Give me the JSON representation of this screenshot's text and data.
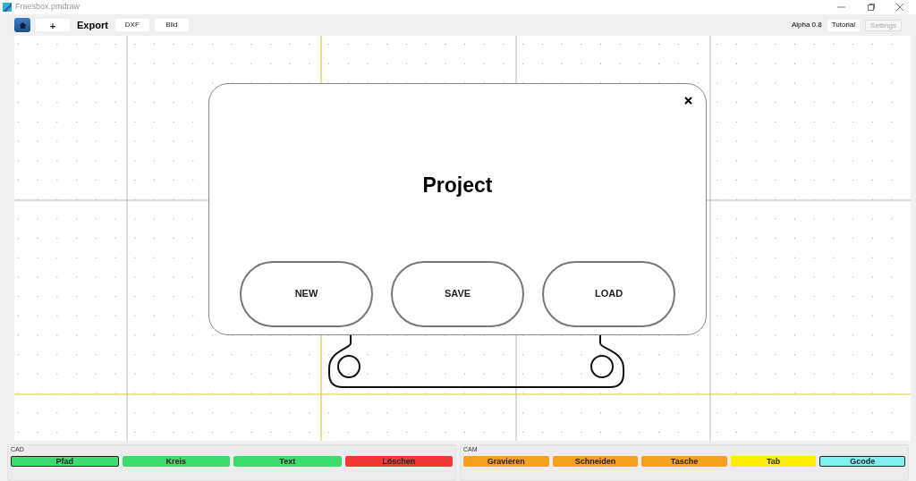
{
  "window": {
    "title": "Fraesbox.pmdraw"
  },
  "toolbar": {
    "left": [
      {
        "kind": "home"
      },
      {
        "kind": "button",
        "label": "+"
      },
      {
        "kind": "label",
        "label": "Export"
      },
      {
        "kind": "button",
        "label": "DXF"
      },
      {
        "kind": "button",
        "label": "Bild"
      }
    ],
    "version": "Alpha 0.8",
    "right": [
      {
        "label": "Tutorial",
        "disabled": false
      },
      {
        "label": "Settings",
        "disabled": true
      }
    ]
  },
  "dialog": {
    "title": "Project",
    "buttons": [
      "NEW",
      "SAVE",
      "LOAD"
    ]
  },
  "panels": [
    {
      "title": "CAD",
      "buttons": [
        {
          "label": "Pfad",
          "color": "#3ddc6f",
          "selected": true
        },
        {
          "label": "Kreis",
          "color": "#3ddc6f",
          "selected": false
        },
        {
          "label": "Text",
          "color": "#3ddc6f",
          "selected": false
        },
        {
          "label": "Löschen",
          "color": "#f43838",
          "selected": false
        }
      ]
    },
    {
      "title": "CAM",
      "buttons": [
        {
          "label": "Gravieren",
          "color": "#f7a020",
          "selected": false
        },
        {
          "label": "Schneiden",
          "color": "#f7a020",
          "selected": false
        },
        {
          "label": "Tasche",
          "color": "#f7a020",
          "selected": false
        },
        {
          "label": "Tab",
          "color": "#ffee00",
          "selected": false
        },
        {
          "label": "Gcode",
          "color": "#7ff0f0",
          "selected": true
        }
      ]
    }
  ]
}
